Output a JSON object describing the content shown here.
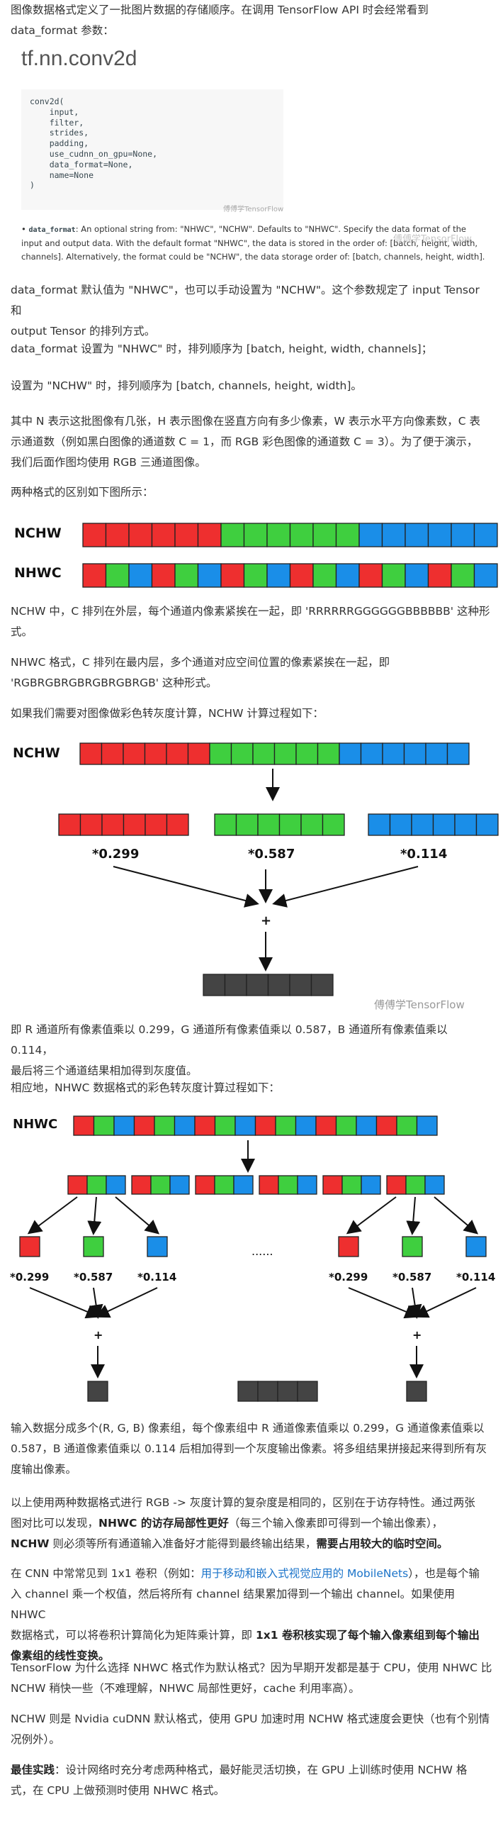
{
  "intro": {
    "line1": "图像数据格式定义了一批图片数据的存储顺序。在调用 TensorFlow API 时会经常看到",
    "line2": "data_format 参数："
  },
  "api": {
    "title": "tf.nn.conv2d",
    "code_lines": [
      "conv2d(",
      "    input,",
      "    filter,",
      "    strides,",
      "    padding,",
      "    use_cudnn_on_gpu=None,",
      "    data_format=None,",
      "    name=None",
      ")"
    ],
    "watermark": "傅傅学TensorFlow",
    "desc_bullet": "•",
    "desc_param": "data_format",
    "desc_line1": ": An optional string from: \"NHWC\", \"NCHW\". Defaults to \"NHWC\". Specify the data format of the",
    "desc_line2": "input and output data. With the default format \"NHWC\", the data is stored in the order of: [batch, height, width,",
    "desc_line3": "channels]. Alternatively, the format could be \"NCHW\", the data storage order of: [batch, channels, height, width].",
    "desc_watermark": "傅傅学TensorFlow"
  },
  "paragraphs": {
    "p1_line1": "data_format 默认值为 \"NHWC\"，也可以手动设置为 \"NCHW\"。这个参数规定了 input Tensor 和",
    "p1_line2": "output Tensor 的排列方式。",
    "p2": "data_format 设置为 \"NHWC\" 时，排列顺序为 [batch, height, width, channels]；",
    "p3": "设置为 \"NCHW\" 时，排列顺序为 [batch, channels, height, width]。",
    "p4_line1": "其中 N 表示这批图像有几张，H 表示图像在竖直方向有多少像素，W 表示水平方向像素数，C 表",
    "p4_line2": "示通道数（例如黑白图像的通道数 C = 1，而 RGB 彩色图像的通道数 C = 3）。为了便于演示，",
    "p4_line3": "我们后面作图均使用 RGB 三通道图像。",
    "p5": "两种格式的区别如下图所示：",
    "p6_line1": "NCHW 中，C 排列在外层，每个通道内像素紧挨在一起，即 'RRRRRRGGGGGGBBBBBB' 这种形",
    "p6_line2": "式。",
    "p7_line1": "NHWC 格式，C 排列在最内层，多个通道对应空间位置的像素紧挨在一起，即",
    "p7_line2": "'RGBRGBRGBRGBRGBRGB' 这种形式。",
    "p8": "如果我们需要对图像做彩色转灰度计算，NCHW 计算过程如下：",
    "p9_line1": "即 R 通道所有像素值乘以 0.299，G 通道所有像素值乘以 0.587，B 通道所有像素值乘以 0.114，",
    "p9_line2": "最后将三个通道结果相加得到灰度值。",
    "p10": "相应地，NHWC 数据格式的彩色转灰度计算过程如下：",
    "p11_line1": "输入数据分成多个(R, G, B) 像素组，每个像素组中 R 通道像素值乘以 0.299，G 通道像素值乘以",
    "p11_line2": "0.587，B 通道像素值乘以 0.114 后相加得到一个灰度输出像素。将多组结果拼接起来得到所有灰",
    "p11_line3": "度输出像素。",
    "p12_line1": "以上使用两种数据格式进行 RGB -> 灰度计算的复杂度是相同的，区别在于访存特性。通过两张",
    "p12_line2a": "图对比可以发现，",
    "p12_line2b": "NHWC 的访存局部性更好",
    "p12_line2c": "（每三个输入像素即可得到一个输出像素），",
    "p12_line3a": "NCHW",
    "p12_line3b": " 则必须等所有通道输入准备好才能得到最终输出结果，",
    "p12_line3c": "需要占用较大的临时空间。",
    "p13_line1a": "在 CNN 中常常见到 1x1 卷积（例如：",
    "p13_link": "用于移动和嵌入式视觉应用的 MobileNets",
    "p13_line1b": "），也是每个输",
    "p13_line2": "入 channel 乘一个权值，然后将所有 channel 结果累加得到一个输出 channel。如果使用 NHWC",
    "p13_line3a": "数据格式，可以将卷积计算简化为矩阵乘计算，即 ",
    "p13_line3b": "1x1 卷积核实现了每个输入像素组到每个输出",
    "p13_line4": "像素组的线性变换。",
    "p14_line1": "TensorFlow 为什么选择 NHWC 格式作为默认格式？因为早期开发都是基于 CPU，使用 NHWC 比",
    "p14_line2": "NCHW 稍快一些（不难理解，NHWC 局部性更好，cache 利用率高）。",
    "p15_line1": "NCHW 则是 Nvidia cuDNN 默认格式，使用 GPU 加速时用 NCHW 格式速度会更快（也有个别情",
    "p15_line2": "况例外）。",
    "p16_line1a": "最佳实践",
    "p16_line1b": "：设计网络时充分考虑两种格式，最好能灵活切换，在 GPU 上训练时使用 NCHW 格",
    "p16_line2": "式，在 CPU 上做预测时使用 NHWC 格式。"
  },
  "diagram1": {
    "label_nchw": "NCHW",
    "label_nhwc": "NHWC"
  },
  "diagram2": {
    "label": "NCHW",
    "w_r": "*0.299",
    "w_g": "*0.587",
    "w_b": "*0.114",
    "plus": "+",
    "watermark": "傅傅学TensorFlow"
  },
  "diagram3": {
    "label": "NHWC",
    "w_r": "*0.299",
    "w_g": "*0.587",
    "w_b": "*0.114",
    "plus": "+",
    "dots": "......"
  },
  "colors": {
    "red": "#ee2f2f",
    "green": "#3fcf3f",
    "blue": "#1a8ee8",
    "gray": "#444444",
    "link": "#1a73c9"
  }
}
